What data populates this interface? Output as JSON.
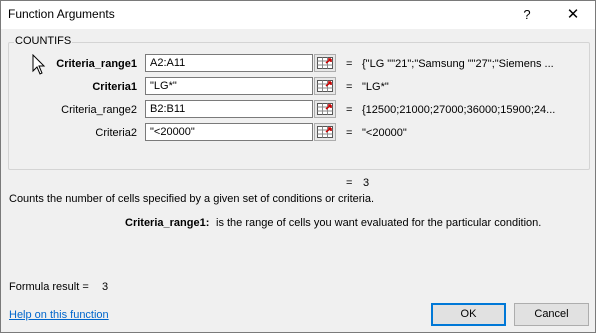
{
  "window": {
    "title": "Function Arguments",
    "help_glyph": "?",
    "close_glyph": "✕"
  },
  "function_name": "COUNTIFS",
  "arguments": [
    {
      "label": "Criteria_range1",
      "value": "A2:A11",
      "result": "{\"LG \"\"21\";\"Samsung \"\"27\";\"Siemens ...",
      "bold": true
    },
    {
      "label": "Criteria1",
      "value": "\"LG*\"",
      "result": "\"LG*\"",
      "bold": true
    },
    {
      "label": "Criteria_range2",
      "value": "B2:B11",
      "result": "{12500;21000;27000;36000;15900;24...",
      "bold": false
    },
    {
      "label": "Criteria2",
      "value": "\"<20000\"",
      "result": "\"<20000\"",
      "bold": false
    }
  ],
  "equals": "=",
  "function_result": "3",
  "description": "Counts the number of cells specified by a given set of conditions or criteria.",
  "arg_description": {
    "label": "Criteria_range1:",
    "text": "is the range of cells you want evaluated for the particular condition."
  },
  "formula_result": {
    "label": "Formula result =",
    "value": "3"
  },
  "help_link": "Help on this function",
  "buttons": {
    "ok": "OK",
    "cancel": "Cancel"
  }
}
